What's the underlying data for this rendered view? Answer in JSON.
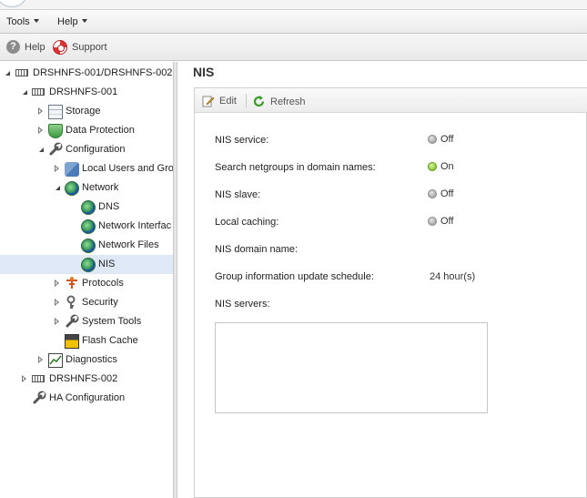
{
  "menubar": {
    "tools_label": "Tools",
    "help_label": "Help"
  },
  "toolbar": {
    "help_label": "Help",
    "support_label": "Support"
  },
  "tree": {
    "root": "DRSHNFS-001/DRSHNFS-002",
    "node1": "DRSHNFS-001",
    "storage": "Storage",
    "data_protection": "Data Protection",
    "configuration": "Configuration",
    "local_users": "Local Users and Gro",
    "network": "Network",
    "dns": "DNS",
    "network_interfaces": "Network Interfac",
    "network_files": "Network Files",
    "nis": "NIS",
    "protocols": "Protocols",
    "security": "Security",
    "system_tools": "System Tools",
    "flash_cache": "Flash Cache",
    "diagnostics": "Diagnostics",
    "node2": "DRSHNFS-002",
    "ha_configuration": "HA Configuration"
  },
  "page": {
    "title": "NIS",
    "edit_label": "Edit",
    "refresh_label": "Refresh"
  },
  "fields": {
    "nis_service_label": "NIS service:",
    "nis_service_value": "Off",
    "search_netgroups_label": "Search netgroups in domain names:",
    "search_netgroups_value": "On",
    "nis_slave_label": "NIS slave:",
    "nis_slave_value": "Off",
    "local_caching_label": "Local caching:",
    "local_caching_value": "Off",
    "nis_domain_label": "NIS domain name:",
    "group_schedule_label": "Group information update schedule:",
    "group_schedule_value": "24 hour(s)",
    "nis_servers_label": "NIS servers:"
  },
  "colors": {
    "selection": "#dfe8f6",
    "status_on": "#6fb81c",
    "status_off": "#8e8e8e"
  }
}
